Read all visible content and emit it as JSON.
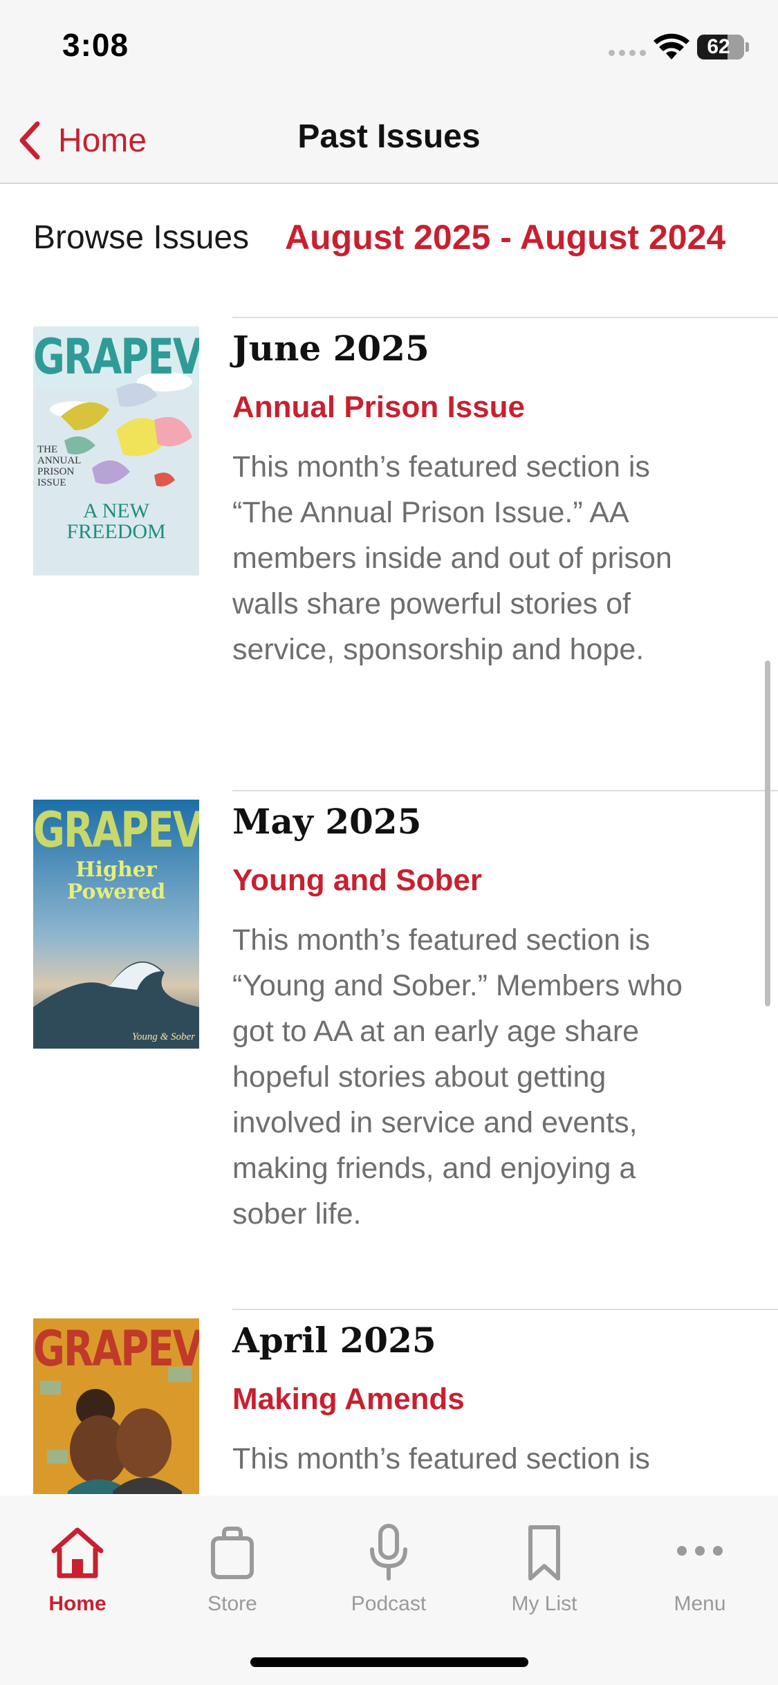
{
  "status_bar": {
    "time": "3:08",
    "battery": "62"
  },
  "nav": {
    "back_label": "Home",
    "title": "Past Issues"
  },
  "browse": {
    "label": "Browse Issues",
    "range": "August 2025 - August 2024"
  },
  "issues": [
    {
      "date": "June 2025",
      "theme": "Annual Prison Issue",
      "description": "This month’s featured section is “The Annual Prison Issue.” AA members inside and out of prison walls share powerful stories of service, sponsorship and hope.",
      "cover": {
        "masthead": "GRAPEVINE",
        "headline_1": "A NEW",
        "headline_2": "FREEDOM",
        "kicker": "THE ANNUAL PRISON ISSUE"
      }
    },
    {
      "date": "May 2025",
      "theme": "Young and Sober",
      "description": "This month’s featured section is “Young and Sober.” Members who got to AA at an early age share hopeful stories about getting involved in service and events, making friends, and enjoying a sober life.",
      "cover": {
        "masthead": "GRAPEVINE",
        "headline_1": "Higher",
        "headline_2": "Powered",
        "kicker": "Young & Sober"
      }
    },
    {
      "date": "April 2025",
      "theme": "Making Amends",
      "description": "This month’s featured section is",
      "cover": {
        "masthead": "GRAPEVINE"
      }
    }
  ],
  "tabs": [
    {
      "label": "Home",
      "icon": "house-icon",
      "active": true
    },
    {
      "label": "Store",
      "icon": "shopping-bag-icon",
      "active": false
    },
    {
      "label": "Podcast",
      "icon": "microphone-icon",
      "active": false
    },
    {
      "label": "My List",
      "icon": "bookmark-icon",
      "active": false
    },
    {
      "label": "Menu",
      "icon": "more-dots-icon",
      "active": false
    }
  ],
  "colors": {
    "accent": "#c8202f",
    "text_muted": "#6e6e6e",
    "tab_inactive": "#9a9a9a"
  }
}
